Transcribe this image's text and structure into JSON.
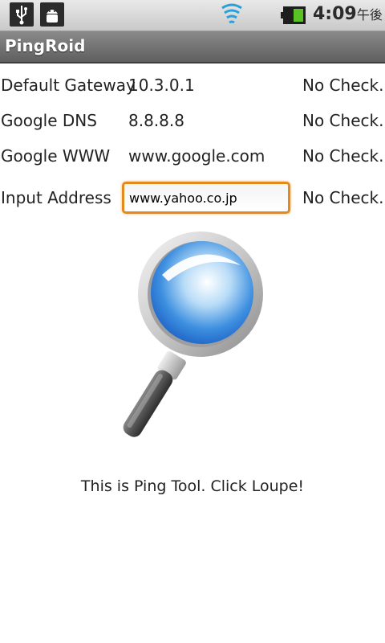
{
  "status_bar": {
    "icons": [
      "usb-icon",
      "android-debug-icon",
      "wifi-icon",
      "battery-icon"
    ],
    "time": "4:09",
    "ampm": "午後"
  },
  "app": {
    "title": "PingRoid"
  },
  "rows": [
    {
      "label": "Default Gateway",
      "address": "10.3.0.1",
      "status": "No Check..."
    },
    {
      "label": "Google DNS",
      "address": "8.8.8.8",
      "status": "No Check..."
    },
    {
      "label": "Google WWW",
      "address": "www.google.com",
      "status": "No Check..."
    }
  ],
  "input_row": {
    "label": "Input Address",
    "value": "www.yahoo.co.jp",
    "status": "No Check..."
  },
  "loupe": {
    "icon": "magnifier-icon"
  },
  "hint": "This is Ping Tool. Click Loupe!",
  "colors": {
    "input_focus": "#e38a1f",
    "titlebar": "#6f6f6f",
    "battery": "#58c322",
    "wifi": "#2ba0d8"
  }
}
